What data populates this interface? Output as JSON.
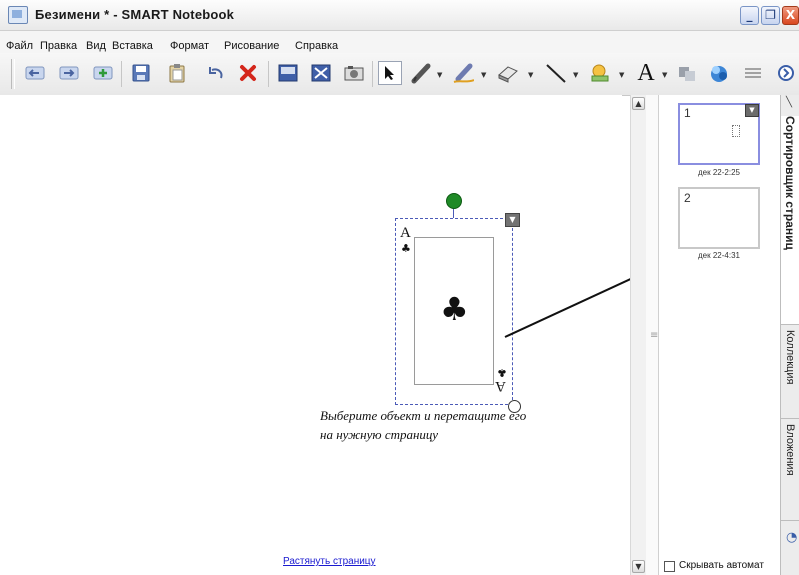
{
  "window": {
    "title": "Безимени * - SMART Notebook",
    "controls": [
      "_",
      "❐",
      "X"
    ]
  },
  "menu": {
    "items": [
      "Файл",
      "Правка",
      "Вид",
      "Вставка",
      "Формат",
      "Рисование",
      "Справка"
    ]
  },
  "toolbar": {
    "icons": [
      "back-icon",
      "forward-icon",
      "add-page-icon",
      "save-icon",
      "paste-icon",
      "undo-icon",
      "delete-icon",
      "screen-shade-icon",
      "full-screen-icon",
      "capture-icon",
      "select-icon",
      "pen-icon",
      "creative-pen-icon",
      "eraser-icon",
      "line-icon",
      "shape-icon",
      "text-icon",
      "fill-icon",
      "properties-icon",
      "more-icon"
    ],
    "text_tool_label": "A"
  },
  "canvas": {
    "card": {
      "rank": "A",
      "suit": "♣",
      "menu_glyph": "▼"
    },
    "instruction_line1": "Выберите объект и  перетащите его",
    "instruction_line2": " на нужную страницу",
    "stretch_link": "Растянуть страницу"
  },
  "scrollbar": {
    "up": "▲",
    "down": "▼"
  },
  "sorter": {
    "pages": [
      {
        "number": "1",
        "date": "дек 22-2:25",
        "active": true
      },
      {
        "number": "2",
        "date": "дек 22-4:31",
        "active": false
      }
    ],
    "thumb_menu": "▼",
    "hide_label": "Скрывать автомат"
  },
  "tabs": {
    "sorter": "Сортировщик страниц",
    "gallery": "Коллекция",
    "attachments": "Вложения"
  },
  "colors": {
    "selection": "#4b5ab7",
    "rotate_handle": "#1f8a27",
    "link": "#1a1ad0",
    "active_thumb": "#8a8ee0"
  }
}
